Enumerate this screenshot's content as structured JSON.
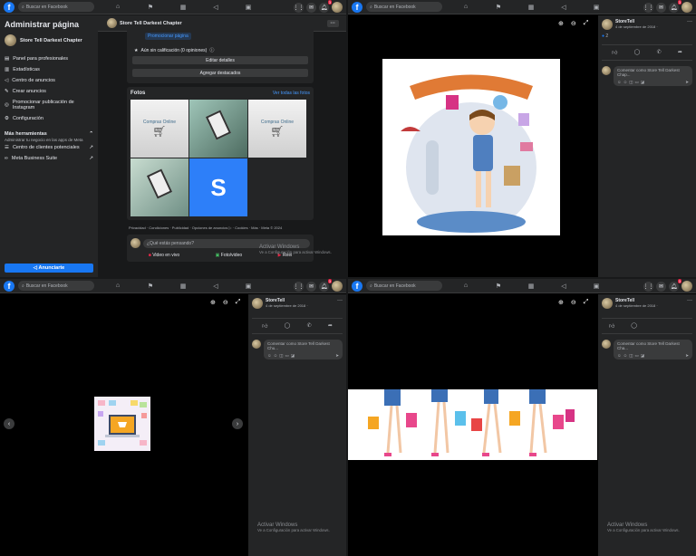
{
  "search": {
    "placeholder": "Buscar en Facebook"
  },
  "sidebar": {
    "title": "Administrar página",
    "page_name": "Store Tell Darkest Chapter",
    "items": [
      {
        "label": "Panel para profesionales",
        "icon": "briefcase-icon"
      },
      {
        "label": "Estadísticas",
        "icon": "chart-icon"
      },
      {
        "label": "Centro de anuncios",
        "icon": "megaphone-icon"
      },
      {
        "label": "Crear anuncios",
        "icon": "pencil-icon"
      },
      {
        "label": "Promocionar publicación de Instagram",
        "icon": "instagram-icon"
      },
      {
        "label": "Configuración",
        "icon": "gear-icon"
      }
    ],
    "more_tools": "Más herramientas",
    "more_tools_sub": "Administrar tu negocio en las apps de Meta",
    "links": [
      "Centro de clientes potenciales",
      "Meta Business Suite"
    ],
    "advertise_button": "Anunciarte"
  },
  "pagebar": {
    "name": "Store Tell Darkest Chapter",
    "more": "···"
  },
  "feed": {
    "promote_page": "Promocionar página",
    "rating": "Aún sin calificación (0 opiniones)",
    "edit_details": "Editar detalles",
    "add_featured": "Agregar destacados",
    "photos_title": "Fotos",
    "photos_link": "Ver todas las fotos",
    "photo_labels": [
      "Compras Online",
      "",
      "Compras Online",
      "",
      "S"
    ],
    "footer": "Privacidad · Condiciones · Publicidad · Opciones de anuncios ▷ · Cookies · Más · Meta © 2024",
    "composer_placeholder": "¿Qué estás pensando?",
    "composer_actions": [
      "Video en vivo",
      "Foto/video",
      "Reel"
    ]
  },
  "watermark": {
    "title": "Activar Windows",
    "sub": "Ve a Configuración para activar Windows."
  },
  "post": {
    "author_q2": "StoreTell",
    "author": "StoreTell",
    "date": "4 de septiembre de 2018 · ",
    "reactions_count": "2",
    "comment_placeholder": "Comentar como Store Tell Darkest Chap...",
    "comment_placeholder_q3": "Comentar como Store Tell Darkest Chu...",
    "comment_placeholder_q4": "Comentar como Store Tell Darkest Cha..."
  },
  "notifications_badge": "3",
  "colors": {
    "facebook_blue": "#1877f2",
    "dark_bg": "#18191a",
    "panel_bg": "#242526",
    "badge_red": "#e41e3f"
  }
}
